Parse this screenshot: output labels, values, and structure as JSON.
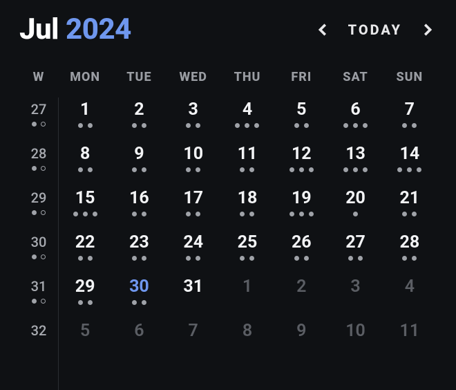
{
  "header": {
    "month": "Jul",
    "year": "2024",
    "today_label": "TODAY"
  },
  "colors": {
    "accent": "#6f97ee",
    "bg": "#0f1114"
  },
  "weekday_labels": [
    "W",
    "MON",
    "TUE",
    "WED",
    "THU",
    "FRI",
    "SAT",
    "SUN"
  ],
  "weeks": [
    {
      "num": "27",
      "week_dots": [
        "solid",
        "hollow"
      ],
      "days": [
        {
          "n": "1",
          "dots": 2,
          "outside": false,
          "selected": false
        },
        {
          "n": "2",
          "dots": 2,
          "outside": false,
          "selected": false
        },
        {
          "n": "3",
          "dots": 2,
          "outside": false,
          "selected": false
        },
        {
          "n": "4",
          "dots": 3,
          "outside": false,
          "selected": false
        },
        {
          "n": "5",
          "dots": 2,
          "outside": false,
          "selected": false
        },
        {
          "n": "6",
          "dots": 3,
          "outside": false,
          "selected": false
        },
        {
          "n": "7",
          "dots": 2,
          "outside": false,
          "selected": false
        }
      ]
    },
    {
      "num": "28",
      "week_dots": [
        "solid",
        "hollow"
      ],
      "days": [
        {
          "n": "8",
          "dots": 2,
          "outside": false,
          "selected": false
        },
        {
          "n": "9",
          "dots": 2,
          "outside": false,
          "selected": false
        },
        {
          "n": "10",
          "dots": 2,
          "outside": false,
          "selected": false
        },
        {
          "n": "11",
          "dots": 2,
          "outside": false,
          "selected": false
        },
        {
          "n": "12",
          "dots": 3,
          "outside": false,
          "selected": false
        },
        {
          "n": "13",
          "dots": 3,
          "outside": false,
          "selected": false
        },
        {
          "n": "14",
          "dots": 3,
          "outside": false,
          "selected": false
        }
      ]
    },
    {
      "num": "29",
      "week_dots": [
        "solid",
        "hollow"
      ],
      "days": [
        {
          "n": "15",
          "dots": 3,
          "outside": false,
          "selected": false
        },
        {
          "n": "16",
          "dots": 2,
          "outside": false,
          "selected": false
        },
        {
          "n": "17",
          "dots": 2,
          "outside": false,
          "selected": false
        },
        {
          "n": "18",
          "dots": 2,
          "outside": false,
          "selected": false
        },
        {
          "n": "19",
          "dots": 3,
          "outside": false,
          "selected": false
        },
        {
          "n": "20",
          "dots": 1,
          "outside": false,
          "selected": false
        },
        {
          "n": "21",
          "dots": 2,
          "outside": false,
          "selected": false
        }
      ]
    },
    {
      "num": "30",
      "week_dots": [
        "solid",
        "hollow"
      ],
      "days": [
        {
          "n": "22",
          "dots": 2,
          "outside": false,
          "selected": false
        },
        {
          "n": "23",
          "dots": 2,
          "outside": false,
          "selected": false
        },
        {
          "n": "24",
          "dots": 2,
          "outside": false,
          "selected": false
        },
        {
          "n": "25",
          "dots": 2,
          "outside": false,
          "selected": false
        },
        {
          "n": "26",
          "dots": 2,
          "outside": false,
          "selected": false
        },
        {
          "n": "27",
          "dots": 2,
          "outside": false,
          "selected": false
        },
        {
          "n": "28",
          "dots": 2,
          "outside": false,
          "selected": false
        }
      ]
    },
    {
      "num": "31",
      "week_dots": [
        "solid",
        "hollow"
      ],
      "days": [
        {
          "n": "29",
          "dots": 2,
          "outside": false,
          "selected": false
        },
        {
          "n": "30",
          "dots": 2,
          "outside": false,
          "selected": true
        },
        {
          "n": "31",
          "dots": 0,
          "outside": false,
          "selected": false
        },
        {
          "n": "1",
          "dots": 0,
          "outside": true,
          "selected": false
        },
        {
          "n": "2",
          "dots": 0,
          "outside": true,
          "selected": false
        },
        {
          "n": "3",
          "dots": 0,
          "outside": true,
          "selected": false
        },
        {
          "n": "4",
          "dots": 0,
          "outside": true,
          "selected": false
        }
      ]
    },
    {
      "num": "32",
      "week_dots": [],
      "days": [
        {
          "n": "5",
          "dots": 0,
          "outside": true,
          "selected": false
        },
        {
          "n": "6",
          "dots": 0,
          "outside": true,
          "selected": false
        },
        {
          "n": "7",
          "dots": 0,
          "outside": true,
          "selected": false
        },
        {
          "n": "8",
          "dots": 0,
          "outside": true,
          "selected": false
        },
        {
          "n": "9",
          "dots": 0,
          "outside": true,
          "selected": false
        },
        {
          "n": "10",
          "dots": 0,
          "outside": true,
          "selected": false
        },
        {
          "n": "11",
          "dots": 0,
          "outside": true,
          "selected": false
        }
      ]
    }
  ]
}
